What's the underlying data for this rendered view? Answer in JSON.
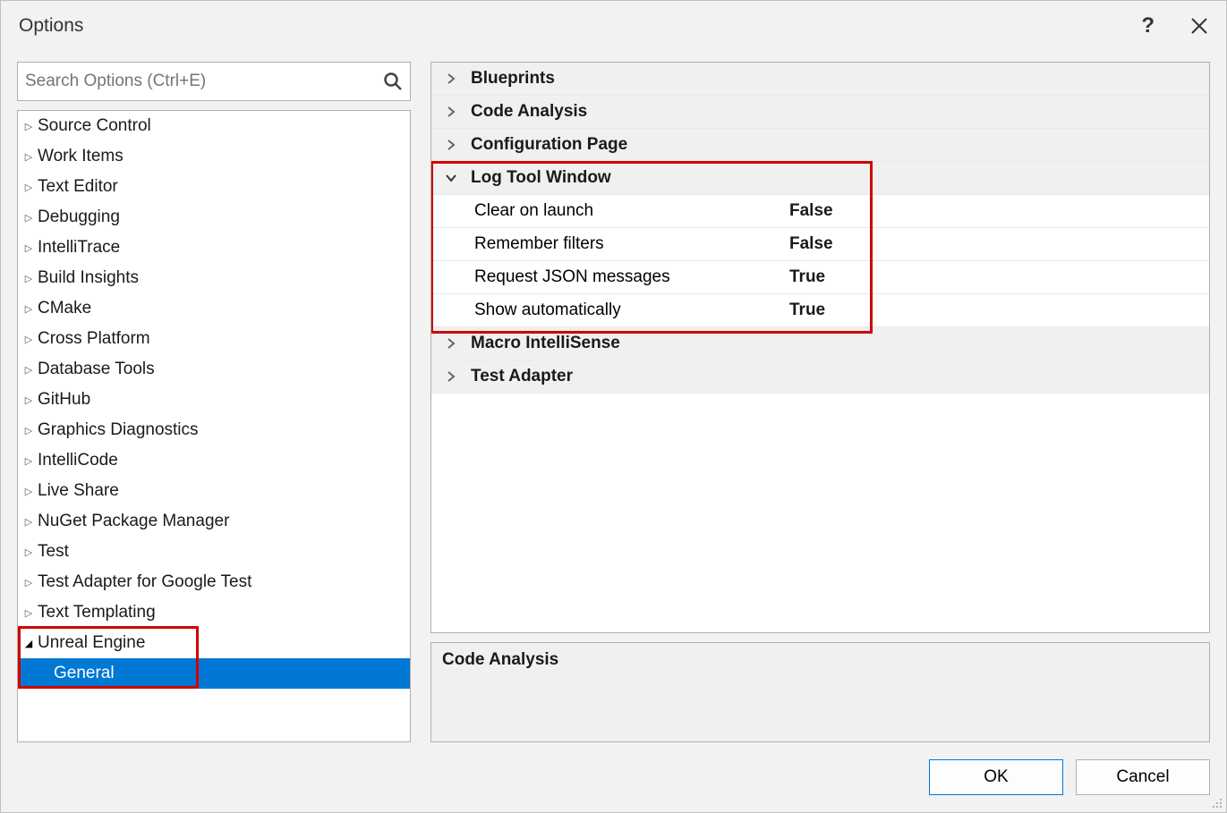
{
  "title": "Options",
  "search": {
    "placeholder": "Search Options (Ctrl+E)"
  },
  "tree": [
    {
      "label": "Source Control",
      "expanded": false
    },
    {
      "label": "Work Items",
      "expanded": false
    },
    {
      "label": "Text Editor",
      "expanded": false
    },
    {
      "label": "Debugging",
      "expanded": false
    },
    {
      "label": "IntelliTrace",
      "expanded": false
    },
    {
      "label": "Build Insights",
      "expanded": false
    },
    {
      "label": "CMake",
      "expanded": false
    },
    {
      "label": "Cross Platform",
      "expanded": false
    },
    {
      "label": "Database Tools",
      "expanded": false
    },
    {
      "label": "GitHub",
      "expanded": false
    },
    {
      "label": "Graphics Diagnostics",
      "expanded": false
    },
    {
      "label": "IntelliCode",
      "expanded": false
    },
    {
      "label": "Live Share",
      "expanded": false
    },
    {
      "label": "NuGet Package Manager",
      "expanded": false
    },
    {
      "label": "Test",
      "expanded": false
    },
    {
      "label": "Test Adapter for Google Test",
      "expanded": false
    },
    {
      "label": "Text Templating",
      "expanded": false
    },
    {
      "label": "Unreal Engine",
      "expanded": true,
      "children": [
        {
          "label": "General",
          "selected": true
        }
      ]
    }
  ],
  "properties": {
    "categories": [
      {
        "name": "Blueprints",
        "expanded": false
      },
      {
        "name": "Code Analysis",
        "expanded": false
      },
      {
        "name": "Configuration Page",
        "expanded": false
      },
      {
        "name": "Log Tool Window",
        "expanded": true,
        "properties": [
          {
            "name": "Clear on launch",
            "value": "False"
          },
          {
            "name": "Remember filters",
            "value": "False"
          },
          {
            "name": "Request JSON messages",
            "value": "True"
          },
          {
            "name": "Show automatically",
            "value": "True"
          }
        ]
      },
      {
        "name": "Macro IntelliSense",
        "expanded": false
      },
      {
        "name": "Test Adapter",
        "expanded": false
      }
    ]
  },
  "description": "Code Analysis",
  "buttons": {
    "ok": "OK",
    "cancel": "Cancel"
  }
}
